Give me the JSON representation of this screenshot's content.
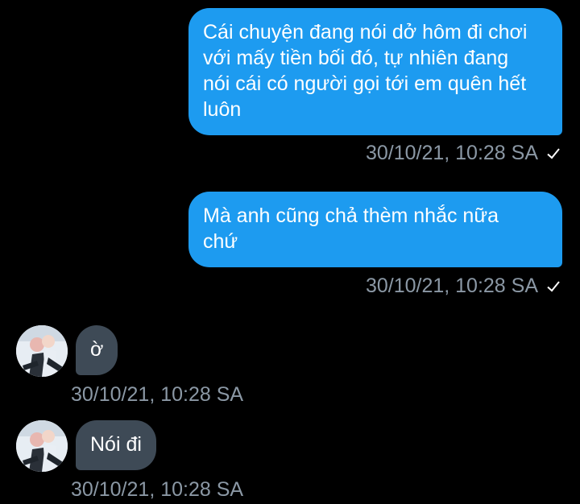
{
  "colors": {
    "background": "#000000",
    "outgoing_bubble": "#1d9bf0",
    "incoming_bubble": "#3e4a56",
    "timestamp": "#8b98a5"
  },
  "messages": [
    {
      "direction": "outgoing",
      "lines": [
        "Cái chuyện đang nói dở hôm đi chơi",
        "với mấy tiền bối đó, tự nhiên đang",
        "nói cái có người gọi tới em quên hết",
        "luôn"
      ],
      "timestamp": "30/10/21, 10:28 SA",
      "status_icon": "check-icon"
    },
    {
      "direction": "outgoing",
      "lines": [
        "Mà anh cũng chả thèm nhắc nữa",
        "chứ"
      ],
      "timestamp": "30/10/21, 10:28 SA",
      "status_icon": "check-icon"
    },
    {
      "direction": "incoming",
      "avatar_icon": "avatar",
      "text": "ờ",
      "timestamp": "30/10/21, 10:28 SA"
    },
    {
      "direction": "incoming",
      "avatar_icon": "avatar",
      "text": "Nói đi",
      "timestamp": "30/10/21, 10:28 SA"
    }
  ]
}
